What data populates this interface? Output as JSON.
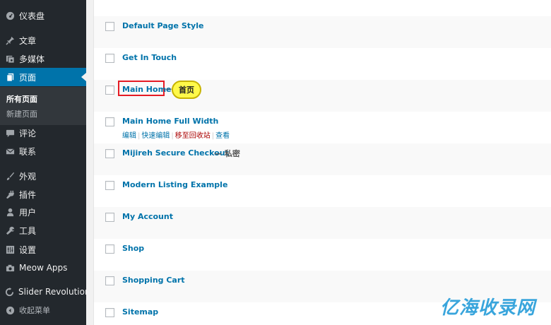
{
  "sidebar": {
    "items": [
      {
        "label": "仪表盘",
        "icon": "dashboard-icon"
      },
      {
        "label": "文章",
        "icon": "pin-icon"
      },
      {
        "label": "多媒体",
        "icon": "media-icon"
      },
      {
        "label": "页面",
        "icon": "pages-icon"
      },
      {
        "label": "评论",
        "icon": "comment-icon"
      },
      {
        "label": "联系",
        "icon": "mail-icon"
      },
      {
        "label": "外观",
        "icon": "brush-icon"
      },
      {
        "label": "插件",
        "icon": "plugin-icon"
      },
      {
        "label": "用户",
        "icon": "user-icon"
      },
      {
        "label": "工具",
        "icon": "wrench-icon"
      },
      {
        "label": "设置",
        "icon": "settings-icon"
      },
      {
        "label": "Meow Apps",
        "icon": "camera-icon"
      },
      {
        "label": "Slider Revolution",
        "icon": "refresh-icon"
      },
      {
        "label": "收起菜单",
        "icon": "collapse-icon"
      }
    ],
    "submenu": {
      "all_pages": "所有页面",
      "new_page": "新建页面"
    }
  },
  "pages": [
    {
      "title": "Default Page Style"
    },
    {
      "title": "Get In Touch"
    },
    {
      "title": "Main Home",
      "annotation": "首页"
    },
    {
      "title": "Main Home Full Width"
    },
    {
      "title": "Mijireh Secure Checkout",
      "state": "— 私密"
    },
    {
      "title": "Modern Listing Example"
    },
    {
      "title": "My Account"
    },
    {
      "title": "Shop"
    },
    {
      "title": "Shopping Cart"
    },
    {
      "title": "Sitemap"
    }
  ],
  "row_actions": {
    "edit": "编辑",
    "quick_edit": "快速编辑",
    "trash": "移至回收站",
    "view": "查看",
    "separator": "|"
  },
  "watermark": "亿海收录网",
  "colors": {
    "sidebar_bg": "#23282d",
    "accent": "#0073aa",
    "highlight": "#e51b24",
    "annotation_bg": "#fff94a"
  }
}
